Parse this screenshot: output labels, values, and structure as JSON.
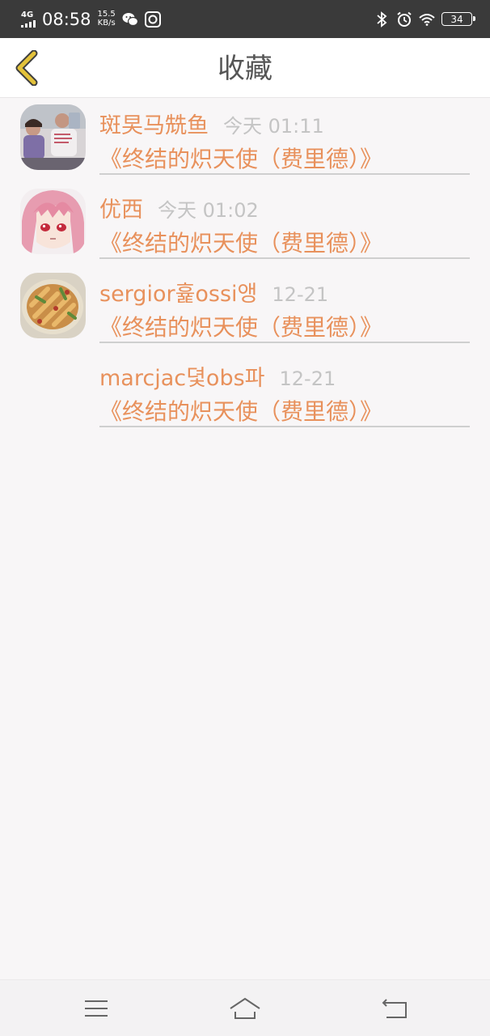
{
  "status_bar": {
    "network": "4G",
    "time": "08:58",
    "speed_value": "15.5",
    "speed_unit": "KB/s",
    "battery": "34",
    "icons": [
      "signal-icon",
      "wechat-icon",
      "app-notification-icon",
      "bluetooth-icon",
      "alarm-icon",
      "wifi-icon",
      "battery-icon"
    ]
  },
  "header": {
    "title": "收藏",
    "back_icon": "chevron-left-icon"
  },
  "items": [
    {
      "name": "斑旲马兟鱼",
      "date": "今天 01:11",
      "text": "《终结的炽天使（费里德）》",
      "avatar": "photo-people"
    },
    {
      "name": "优西",
      "date": "今天 01:02",
      "text": "《终结的炽天使（费里德）》",
      "avatar": "anime-pink-hair"
    },
    {
      "name": "sergior흁ossi앵",
      "date": "12-21",
      "text": "《终结的炽天使（费里德）》",
      "avatar": "food-plate"
    },
    {
      "name": "marcjac뎣obs파",
      "date": "12-21",
      "text": "《终结的炽天使（费里德）》",
      "avatar": ""
    }
  ],
  "nav": {
    "icons": [
      "menu-icon",
      "home-icon",
      "back-icon"
    ]
  },
  "colors": {
    "accent": "#e8915c",
    "date": "#c4c4c4",
    "back_chevron": "#e3c23a",
    "background": "#f8f6f7"
  }
}
